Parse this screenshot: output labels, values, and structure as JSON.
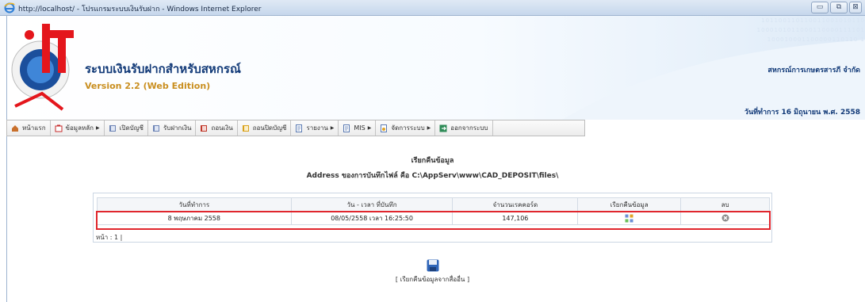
{
  "window": {
    "title": "http://localhost/ - โปรแกรมระบบเงินรับฝาก - Windows Internet Explorer",
    "minimize": "▭",
    "maximize": "⧉",
    "close": "⊠"
  },
  "header": {
    "app_title": "ระบบเงินรับฝากสำหรับสหกรณ์",
    "app_version": "Version 2.2 (Web Edition)",
    "org_name": "สหกรณ์การเกษตรสารภี จำกัด",
    "work_date": "วันที่ทำการ 16 มิถุนายน พ.ศ. 2558",
    "binary_decoration": "101100110110011001010110 1000101011000110000111101 100010001100000110110 1"
  },
  "menu": {
    "items": [
      {
        "label": "หน้าแรก",
        "icon": "home-icon",
        "has_submenu": false
      },
      {
        "label": "ข้อมูลหลัก",
        "icon": "folder-icon",
        "has_submenu": true
      },
      {
        "label": "เปิดบัญชี",
        "icon": "book-icon",
        "has_submenu": false
      },
      {
        "label": "รับฝากเงิน",
        "icon": "book-icon",
        "has_submenu": false
      },
      {
        "label": "ถอนเงิน",
        "icon": "book-red-icon",
        "has_submenu": false
      },
      {
        "label": "ถอนปิดบัญชี",
        "icon": "book-yellow-icon",
        "has_submenu": false
      },
      {
        "label": "รายงาน",
        "icon": "report-icon",
        "has_submenu": true
      },
      {
        "label": "MIS",
        "icon": "report-icon",
        "has_submenu": true
      },
      {
        "label": "จัดการระบบ",
        "icon": "settings-icon",
        "has_submenu": true
      },
      {
        "label": "ออกจากระบบ",
        "icon": "exit-icon",
        "has_submenu": false
      }
    ]
  },
  "main": {
    "heading": "เรียกคืนข้อมูล",
    "address_line": "Address ของการบันทึกไฟล์ คือ C:\\AppServ\\www\\CAD_DEPOSIT\\files\\",
    "table": {
      "columns": [
        "วันที่ทำการ",
        "วัน - เวลา ที่บันทึก",
        "จำนวนเรคคอร์ด",
        "เรียกคืนข้อมูล",
        "ลบ"
      ],
      "rows": [
        {
          "work_date": "8 พฤษภาคม 2558",
          "saved_at": "08/05/2558  เวลา 16:25:50",
          "record_count": "147,106"
        }
      ]
    },
    "pager": "หน้า : 1 |",
    "restore_other_label": "[ เรียกคืนข้อมูลจากสื่ออื่น ]"
  },
  "colors": {
    "highlight": "#e0262d",
    "brand_blue": "#123a78",
    "version_orange": "#c98e1e"
  }
}
